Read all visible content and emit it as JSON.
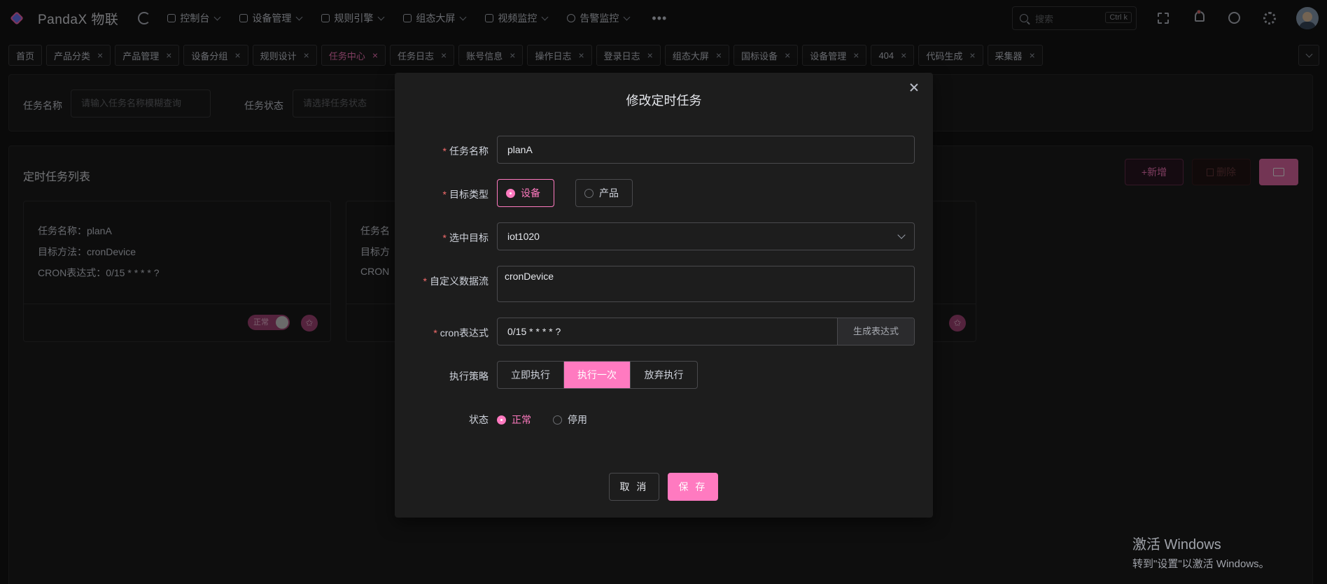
{
  "header": {
    "brand": "PandaX 物联",
    "nav": [
      "控制台",
      "设备管理",
      "规则引擎",
      "组态大屏",
      "视频监控",
      "告警监控"
    ],
    "more": "•••",
    "search_placeholder": "搜索",
    "search_shortcut": "Ctrl k"
  },
  "tabs": [
    {
      "label": "首页",
      "closable": false
    },
    {
      "label": "产品分类",
      "closable": true
    },
    {
      "label": "产品管理",
      "closable": true
    },
    {
      "label": "设备分组",
      "closable": true
    },
    {
      "label": "规则设计",
      "closable": true
    },
    {
      "label": "任务中心",
      "closable": true,
      "active": true
    },
    {
      "label": "任务日志",
      "closable": true
    },
    {
      "label": "账号信息",
      "closable": true
    },
    {
      "label": "操作日志",
      "closable": true
    },
    {
      "label": "登录日志",
      "closable": true
    },
    {
      "label": "组态大屏",
      "closable": true
    },
    {
      "label": "国标设备",
      "closable": true
    },
    {
      "label": "设备管理",
      "closable": true
    },
    {
      "label": "404",
      "closable": true
    },
    {
      "label": "代码生成",
      "closable": true
    },
    {
      "label": "采集器",
      "closable": true
    }
  ],
  "filter": {
    "name_label": "任务名称",
    "name_placeholder": "请输入任务名称模糊查询",
    "status_label": "任务状态",
    "status_placeholder": "请选择任务状态"
  },
  "list": {
    "title": "定时任务列表",
    "add_button": "+新增",
    "delete_button": "删除",
    "cards": [
      {
        "name": "任务名称：planA",
        "method": "目标方法：cronDevice",
        "cron": "CRON表达式：0/15 * * * * ?",
        "status": "正常"
      },
      {
        "name": "任务名",
        "method": "目标方",
        "cron": "CRON"
      }
    ]
  },
  "modal": {
    "title": "修改定时任务",
    "fields": {
      "task_name_label": "任务名称",
      "task_name_value": "planA",
      "target_type_label": "目标类型",
      "target_type_options": [
        "设备",
        "产品"
      ],
      "target_type_selected": "设备",
      "target_label": "选中目标",
      "target_value": "iot1020",
      "dataflow_label": "自定义数据流",
      "dataflow_value": "cronDevice",
      "cron_label": "cron表达式",
      "cron_value": "0/15 * * * * ?",
      "cron_generate": "生成表达式",
      "strategy_label": "执行策略",
      "strategy_options": [
        "立即执行",
        "执行一次",
        "放弃执行"
      ],
      "strategy_selected": "执行一次",
      "status_label": "状态",
      "status_options": [
        "正常",
        "停用"
      ],
      "status_selected": "正常"
    },
    "cancel_button": "取 消",
    "save_button": "保 存"
  },
  "watermark": {
    "line1": "激活 Windows",
    "line2": "转到\"设置\"以激活 Windows。"
  },
  "colors": {
    "accent": "#ff7ac0",
    "required": "#f56c6c",
    "background": "#141414"
  }
}
